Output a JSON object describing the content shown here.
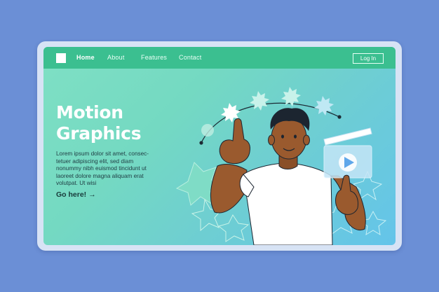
{
  "nav": {
    "items": [
      {
        "label": "Home",
        "active": true
      },
      {
        "label": "About",
        "active": false
      },
      {
        "label": "Features",
        "active": false
      },
      {
        "label": "Contact",
        "active": false
      }
    ],
    "login_label": "Log In"
  },
  "hero": {
    "title": "Motion\nGraphics",
    "body": "Lorem ipsum dolor sit amet, consec-\ntetuer adipiscing elit, sed diam\nnonummy nibh euismod tincidunt ut\nlaoreet dolore magna aliquam erat\nvolutpat. Ut wisi",
    "cta_label": "Go here!",
    "cta_icon": "arrow-right-icon"
  },
  "colors": {
    "page_background": "#6b8fd6",
    "nav_bar": "#3bbf90",
    "screen_gradient_start": "#7fe0c4",
    "screen_gradient_end": "#64c4ea",
    "shirt": "#ffffff",
    "skin": "#9a5a2e",
    "hair": "#1c2530"
  }
}
